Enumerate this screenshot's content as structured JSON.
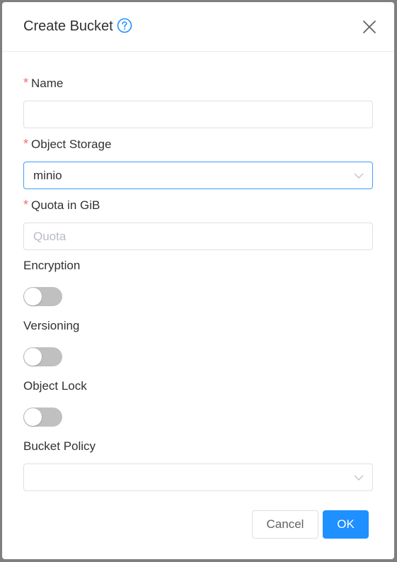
{
  "dialog": {
    "title": "Create Bucket",
    "close_icon": "close-icon",
    "help_icon": "question-circle-icon"
  },
  "form": {
    "name": {
      "label": "Name",
      "required": true,
      "value": "",
      "placeholder": ""
    },
    "object_storage": {
      "label": "Object Storage",
      "required": true,
      "selected": "minio",
      "focused": true
    },
    "quota": {
      "label": "Quota in GiB",
      "required": true,
      "value": "",
      "placeholder": "Quota"
    },
    "encryption": {
      "label": "Encryption",
      "enabled": false
    },
    "versioning": {
      "label": "Versioning",
      "enabled": false
    },
    "object_lock": {
      "label": "Object Lock",
      "enabled": false
    },
    "bucket_policy": {
      "label": "Bucket Policy",
      "selected": ""
    },
    "required_marker": "*"
  },
  "footer": {
    "cancel_label": "Cancel",
    "ok_label": "OK"
  },
  "colors": {
    "primary": "#1e90ff",
    "required": "#f56c6c",
    "switch_off": "#c0c0c0",
    "focus_border": "#409eff"
  }
}
